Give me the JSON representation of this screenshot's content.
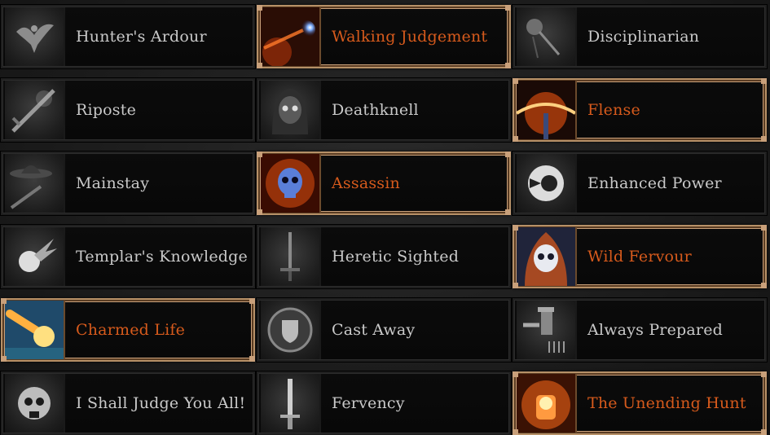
{
  "talents": [
    {
      "label": "Hunter's Ardour",
      "icon": "dove-icon",
      "active": false
    },
    {
      "label": "Walking Judgement",
      "icon": "comet-icon",
      "active": true
    },
    {
      "label": "Disciplinarian",
      "icon": "flail-icon",
      "active": false
    },
    {
      "label": "Riposte",
      "icon": "sword-slash-icon",
      "active": false
    },
    {
      "label": "Deathknell",
      "icon": "hooded-skull-icon",
      "active": false
    },
    {
      "label": "Flense",
      "icon": "explosion-icon",
      "active": true
    },
    {
      "label": "Mainstay",
      "icon": "witch-hunter-hat-icon",
      "active": false
    },
    {
      "label": "Assassin",
      "icon": "blue-skull-icon",
      "active": true
    },
    {
      "label": "Enhanced Power",
      "icon": "power-orb-icon",
      "active": false
    },
    {
      "label": "Templar's Knowledge",
      "icon": "fireball-icon",
      "active": false
    },
    {
      "label": "Heretic Sighted",
      "icon": "longsword-icon",
      "active": false
    },
    {
      "label": "Wild Fervour",
      "icon": "flaming-skull-icon",
      "active": true
    },
    {
      "label": "Charmed Life",
      "icon": "meteor-icon",
      "active": true
    },
    {
      "label": "Cast Away",
      "icon": "shield-icon",
      "active": false
    },
    {
      "label": "Always Prepared",
      "icon": "gunslinger-icon",
      "active": false
    },
    {
      "label": "I Shall Judge You All!",
      "icon": "skull-emblem-icon",
      "active": false
    },
    {
      "label": "Fervency",
      "icon": "glowing-sword-icon",
      "active": false
    },
    {
      "label": "The Unending Hunt",
      "icon": "burning-fist-icon",
      "active": true
    }
  ],
  "colors": {
    "active_label": "#d65a1c",
    "inactive_label": "#c9c9c9",
    "active_border": "#b69067"
  }
}
